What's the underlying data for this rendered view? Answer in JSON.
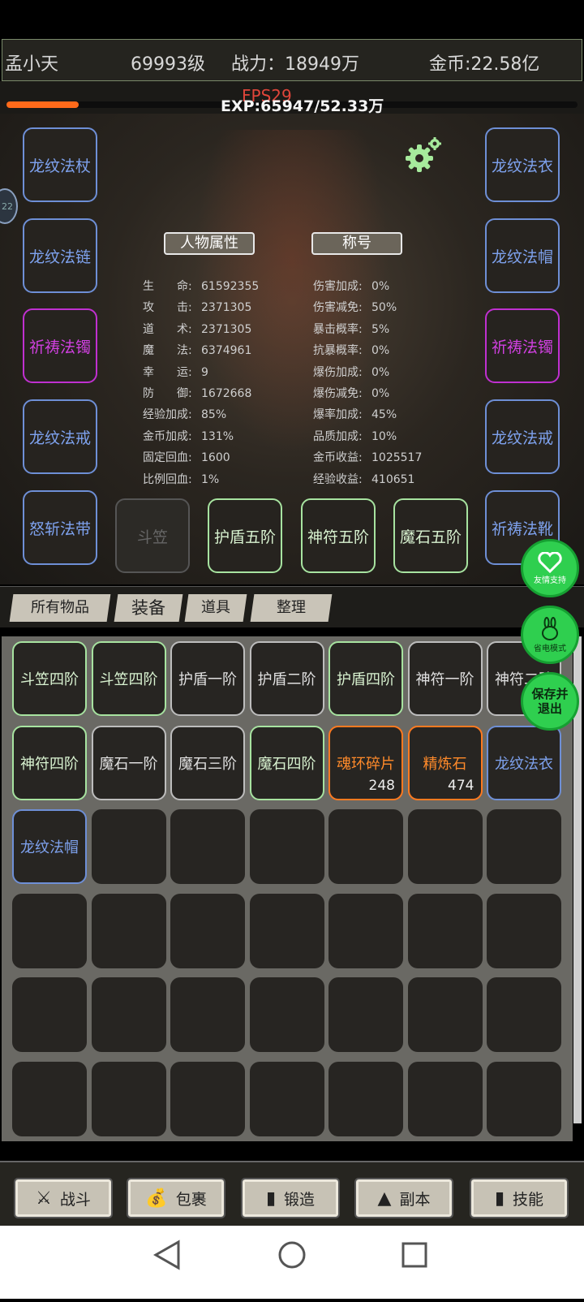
{
  "header": {
    "player_name": "孟小天",
    "level": "69993级",
    "power": "战力：18949万",
    "gold": "金币:22.58亿",
    "fps": "FPS29",
    "exp_text": "EXP:65947/52.33万",
    "exp_progress": 0.126
  },
  "left_badge": "22",
  "equipment_left": [
    "龙纹法杖",
    "龙纹法链",
    "祈祷法镯",
    "龙纹法戒",
    "怒斩法带"
  ],
  "equipment_right": [
    "龙纹法衣",
    "龙纹法帽",
    "祈祷法镯",
    "龙纹法戒",
    "祈祷法靴"
  ],
  "equipment_bottom": [
    "斗笠",
    "护盾五阶",
    "神符五阶",
    "魔石五阶"
  ],
  "attr_buttons": {
    "attributes": "人物属性",
    "title": "称号"
  },
  "stats_left": [
    {
      "k": "生　　命:",
      "v": "61592355"
    },
    {
      "k": "攻　　击:",
      "v": "2371305"
    },
    {
      "k": "道　　术:",
      "v": "2371305"
    },
    {
      "k": "魔　　法:",
      "v": "6374961"
    },
    {
      "k": "幸　　运:",
      "v": "9"
    },
    {
      "k": "防　　御:",
      "v": "1672668"
    },
    {
      "k": "经验加成:",
      "v": "85%"
    },
    {
      "k": "金币加成:",
      "v": "131%"
    },
    {
      "k": "固定回血:",
      "v": "1600"
    },
    {
      "k": "比例回血:",
      "v": "1%"
    }
  ],
  "stats_right": [
    {
      "k": "伤害加成:",
      "v": "0%"
    },
    {
      "k": "伤害减免:",
      "v": "50%"
    },
    {
      "k": "暴击概率:",
      "v": "5%"
    },
    {
      "k": "抗暴概率:",
      "v": "0%"
    },
    {
      "k": "爆伤加成:",
      "v": "0%"
    },
    {
      "k": "爆伤减免:",
      "v": "0%"
    },
    {
      "k": "爆率加成:",
      "v": "45%"
    },
    {
      "k": "品质加成:",
      "v": "10%"
    },
    {
      "k": "金币收益:",
      "v": "1025517"
    },
    {
      "k": "经验收益:",
      "v": "410651"
    }
  ],
  "tabs": [
    "所有物品",
    "装备",
    "道具",
    "整理"
  ],
  "inventory": [
    {
      "name": "斗笠四阶",
      "color": "green"
    },
    {
      "name": "斗笠四阶",
      "color": "green"
    },
    {
      "name": "护盾一阶",
      "color": "white"
    },
    {
      "name": "护盾二阶",
      "color": "white"
    },
    {
      "name": "护盾四阶",
      "color": "green"
    },
    {
      "name": "神符一阶",
      "color": "white"
    },
    {
      "name": "神符二阶",
      "color": "white"
    },
    {
      "name": "神符四阶",
      "color": "green"
    },
    {
      "name": "魔石一阶",
      "color": "white"
    },
    {
      "name": "魔石三阶",
      "color": "white"
    },
    {
      "name": "魔石四阶",
      "color": "green"
    },
    {
      "name": "魂环碎片",
      "color": "orange",
      "count": "248"
    },
    {
      "name": "精炼石",
      "color": "orange",
      "count": "474"
    },
    {
      "name": "龙纹法衣",
      "color": "blue"
    },
    {
      "name": "龙纹法帽",
      "color": "blue"
    }
  ],
  "floating": {
    "support": "友情支持",
    "power_save": "省电模式",
    "save_exit_1": "保存并",
    "save_exit_2": "退出"
  },
  "bottom_nav": [
    {
      "label": "战斗",
      "icon": "crossed-swords-icon",
      "glyph": "⚔"
    },
    {
      "label": "包裹",
      "icon": "money-bag-icon",
      "glyph": "💰"
    },
    {
      "label": "锻造",
      "icon": "book-icon",
      "glyph": "▮"
    },
    {
      "label": "副本",
      "icon": "tower-icon",
      "glyph": "▲"
    },
    {
      "label": "技能",
      "icon": "book-icon",
      "glyph": "▮"
    }
  ],
  "colors": {
    "exp_fill": "#ff6a1a",
    "fab_green": "#2fcf4f",
    "rare_blue": "#7ea2ee",
    "epic_purple": "#d040e0",
    "orange": "#ff8a2a"
  }
}
